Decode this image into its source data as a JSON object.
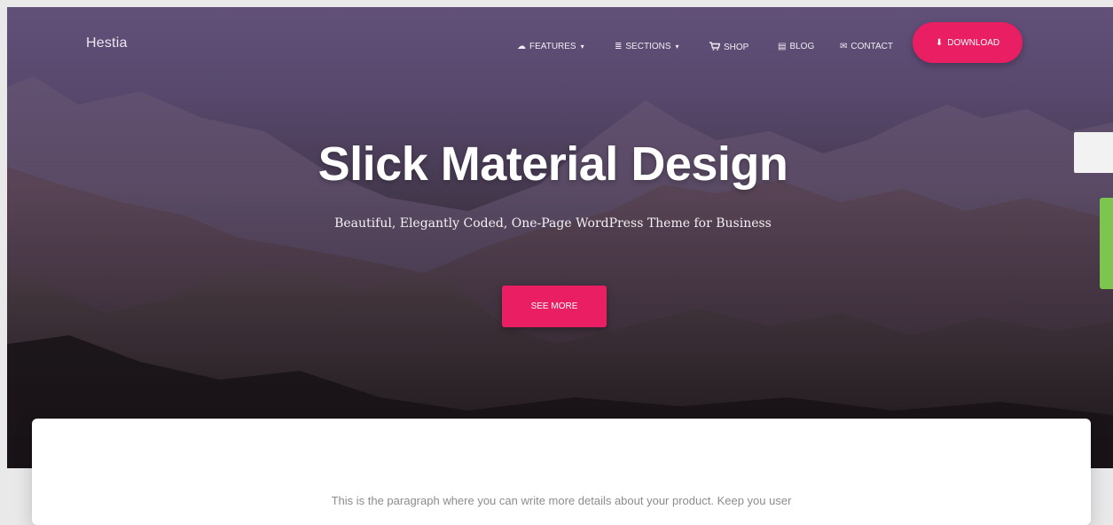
{
  "brand": {
    "name": "Hestia"
  },
  "nav": {
    "items": [
      {
        "label": "FEATURES",
        "icon": "cloud-icon",
        "glyph": "☁",
        "dropdown": true
      },
      {
        "label": "SECTIONS",
        "icon": "list-icon",
        "glyph": "≣",
        "dropdown": true
      },
      {
        "label": "SHOP",
        "icon": "cart-icon",
        "glyph": "🛒",
        "dropdown": false
      },
      {
        "label": "BLOG",
        "icon": "document-icon",
        "glyph": "▤",
        "dropdown": false
      },
      {
        "label": "CONTACT",
        "icon": "envelope-icon",
        "glyph": "✉",
        "dropdown": false
      }
    ],
    "download": {
      "label": "DOWNLOAD",
      "icon": "download-icon",
      "glyph": "⬇"
    }
  },
  "hero": {
    "title": "Slick Material Design",
    "subtitle": "Beautiful, Elegantly Coded, One-Page WordPress Theme for Business",
    "cta": "SEE MORE"
  },
  "content": {
    "paragraph": "This is the paragraph where you can write more details about your product. Keep you user"
  },
  "colors": {
    "accent": "#e91e63",
    "side_tab": "#7cc54f"
  }
}
